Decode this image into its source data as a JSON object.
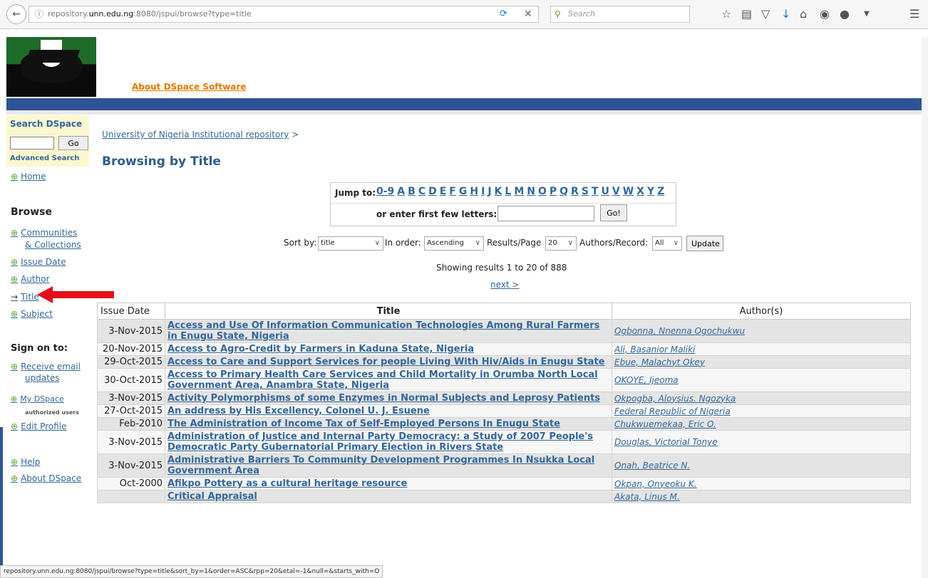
{
  "browser": {
    "url_prefix": "repository.",
    "url_domain": "unn.edu.ng",
    "url_suffix": ":8080/jspui/browse?type=title",
    "search_placeholder": "Search",
    "status_url": "repository.unn.edu.ng:8080/jspui/browse?type=title&sort_by=1&order=ASC&rpp=20&etal=-1&null=&starts_with=O"
  },
  "header": {
    "about_link": "About DSpace Software"
  },
  "sidebar": {
    "search_title": "Search DSpace",
    "go_label": "Go",
    "advanced_search": "Advanced Search",
    "home": "Home",
    "browse_heading": "Browse",
    "browse_items": [
      "Communities",
      "& Collections",
      "Issue Date",
      "Author",
      "Title",
      "Subject"
    ],
    "sign_on_heading": "Sign on to:",
    "receive_email": [
      "Receive email",
      "updates"
    ],
    "my_dspace": "My DSpace",
    "authorized_users": "authorized users",
    "edit_profile": "Edit Profile",
    "help": "Help",
    "about_dspace": "About DSpace"
  },
  "main": {
    "breadcrumb_link": "University of Nigeria Institutional repository",
    "breadcrumb_sep": ">",
    "page_title": "Browsing by Title",
    "jump_to_label": "Jump to:",
    "letters": [
      "0-9",
      "A",
      "B",
      "C",
      "D",
      "E",
      "F",
      "G",
      "H",
      "I",
      "J",
      "K",
      "L",
      "M",
      "N",
      "O",
      "P",
      "Q",
      "R",
      "S",
      "T",
      "U",
      "V",
      "W",
      "X",
      "Y",
      "Z"
    ],
    "enter_letters_label": "or enter first few letters:",
    "go_bang_label": "Go!",
    "sort_by_label": "Sort by:",
    "sort_by_value": "title",
    "order_label": "In order:",
    "order_value": "Ascending",
    "rpp_label": "Results/Page",
    "rpp_value": "20",
    "authors_label": "Authors/Record:",
    "authors_value": "All",
    "update_label": "Update",
    "showing": "Showing results 1 to 20 of 888",
    "next": "next >"
  },
  "table": {
    "headers": [
      "Issue Date",
      "Title",
      "Author(s)"
    ],
    "rows": [
      {
        "date": "3-Nov-2015",
        "title": "Access and Use Of Information Communication Technologies Among Rural Farmers in Enugu State, Nigeria",
        "author": "Ogbonna, Nnenna Ogochukwu"
      },
      {
        "date": "20-Nov-2015",
        "title": "Access to Agro-Credit by Farmers in Kaduna State, Nigeria",
        "author": "Ali, Basanior Maliki"
      },
      {
        "date": "29-Oct-2015",
        "title": "Access to Care and Support Services for people Living With Hiv/Aids in Enugu State",
        "author": "Ebue, Malachyt Okey"
      },
      {
        "date": "30-Oct-2015",
        "title": "Access to Primary Health Care Services and Child Mortality in Orumba North Local Government Area, Anambra State, Nigeria",
        "author": "OKOYE, Ijeoma"
      },
      {
        "date": "3-Nov-2015",
        "title": "Activity Polymorphisms of some Enzymes in Normal Subjects and Leprosy Patients",
        "author": "Okpogba, Aloysius. Ngozyka"
      },
      {
        "date": "27-Oct-2015",
        "title": "An address by His Excellency, Colonel U. J. Esuene",
        "author": "Federal Republic of Nigeria"
      },
      {
        "date": "Feb-2010",
        "title": "The Administration of Income Tax of Self-Employed Persons In Enugu State",
        "author": "Chukwuemekaa, Eric O."
      },
      {
        "date": "3-Nov-2015",
        "title": "Administration of Justice and Internal Party Democracy: a Study of 2007 People's Democratic Party Gubernatorial Primary Election in Rivers State",
        "author": "Douglas, Victorial Tonye"
      },
      {
        "date": "3-Nov-2015",
        "title": "Administrative Barriers To Community Development Programmes In Nsukka Local Government Area",
        "author": "Onah, Beatrice N."
      },
      {
        "date": "Oct-2000",
        "title": "Afikpo Pottery as a cultural heritage resource",
        "author": "Okpan, Onyeoku K."
      },
      {
        "date": "",
        "title": "Critical Appraisal",
        "author": "Akata, Linus M."
      }
    ]
  },
  "colors": {
    "link": "#336699",
    "title_heading": "#2e5c8a",
    "header_bar": "#2f5396",
    "about_link": "#e07a00",
    "search_box_bg": "#fbf7d0",
    "arrow": "#e3101a"
  }
}
